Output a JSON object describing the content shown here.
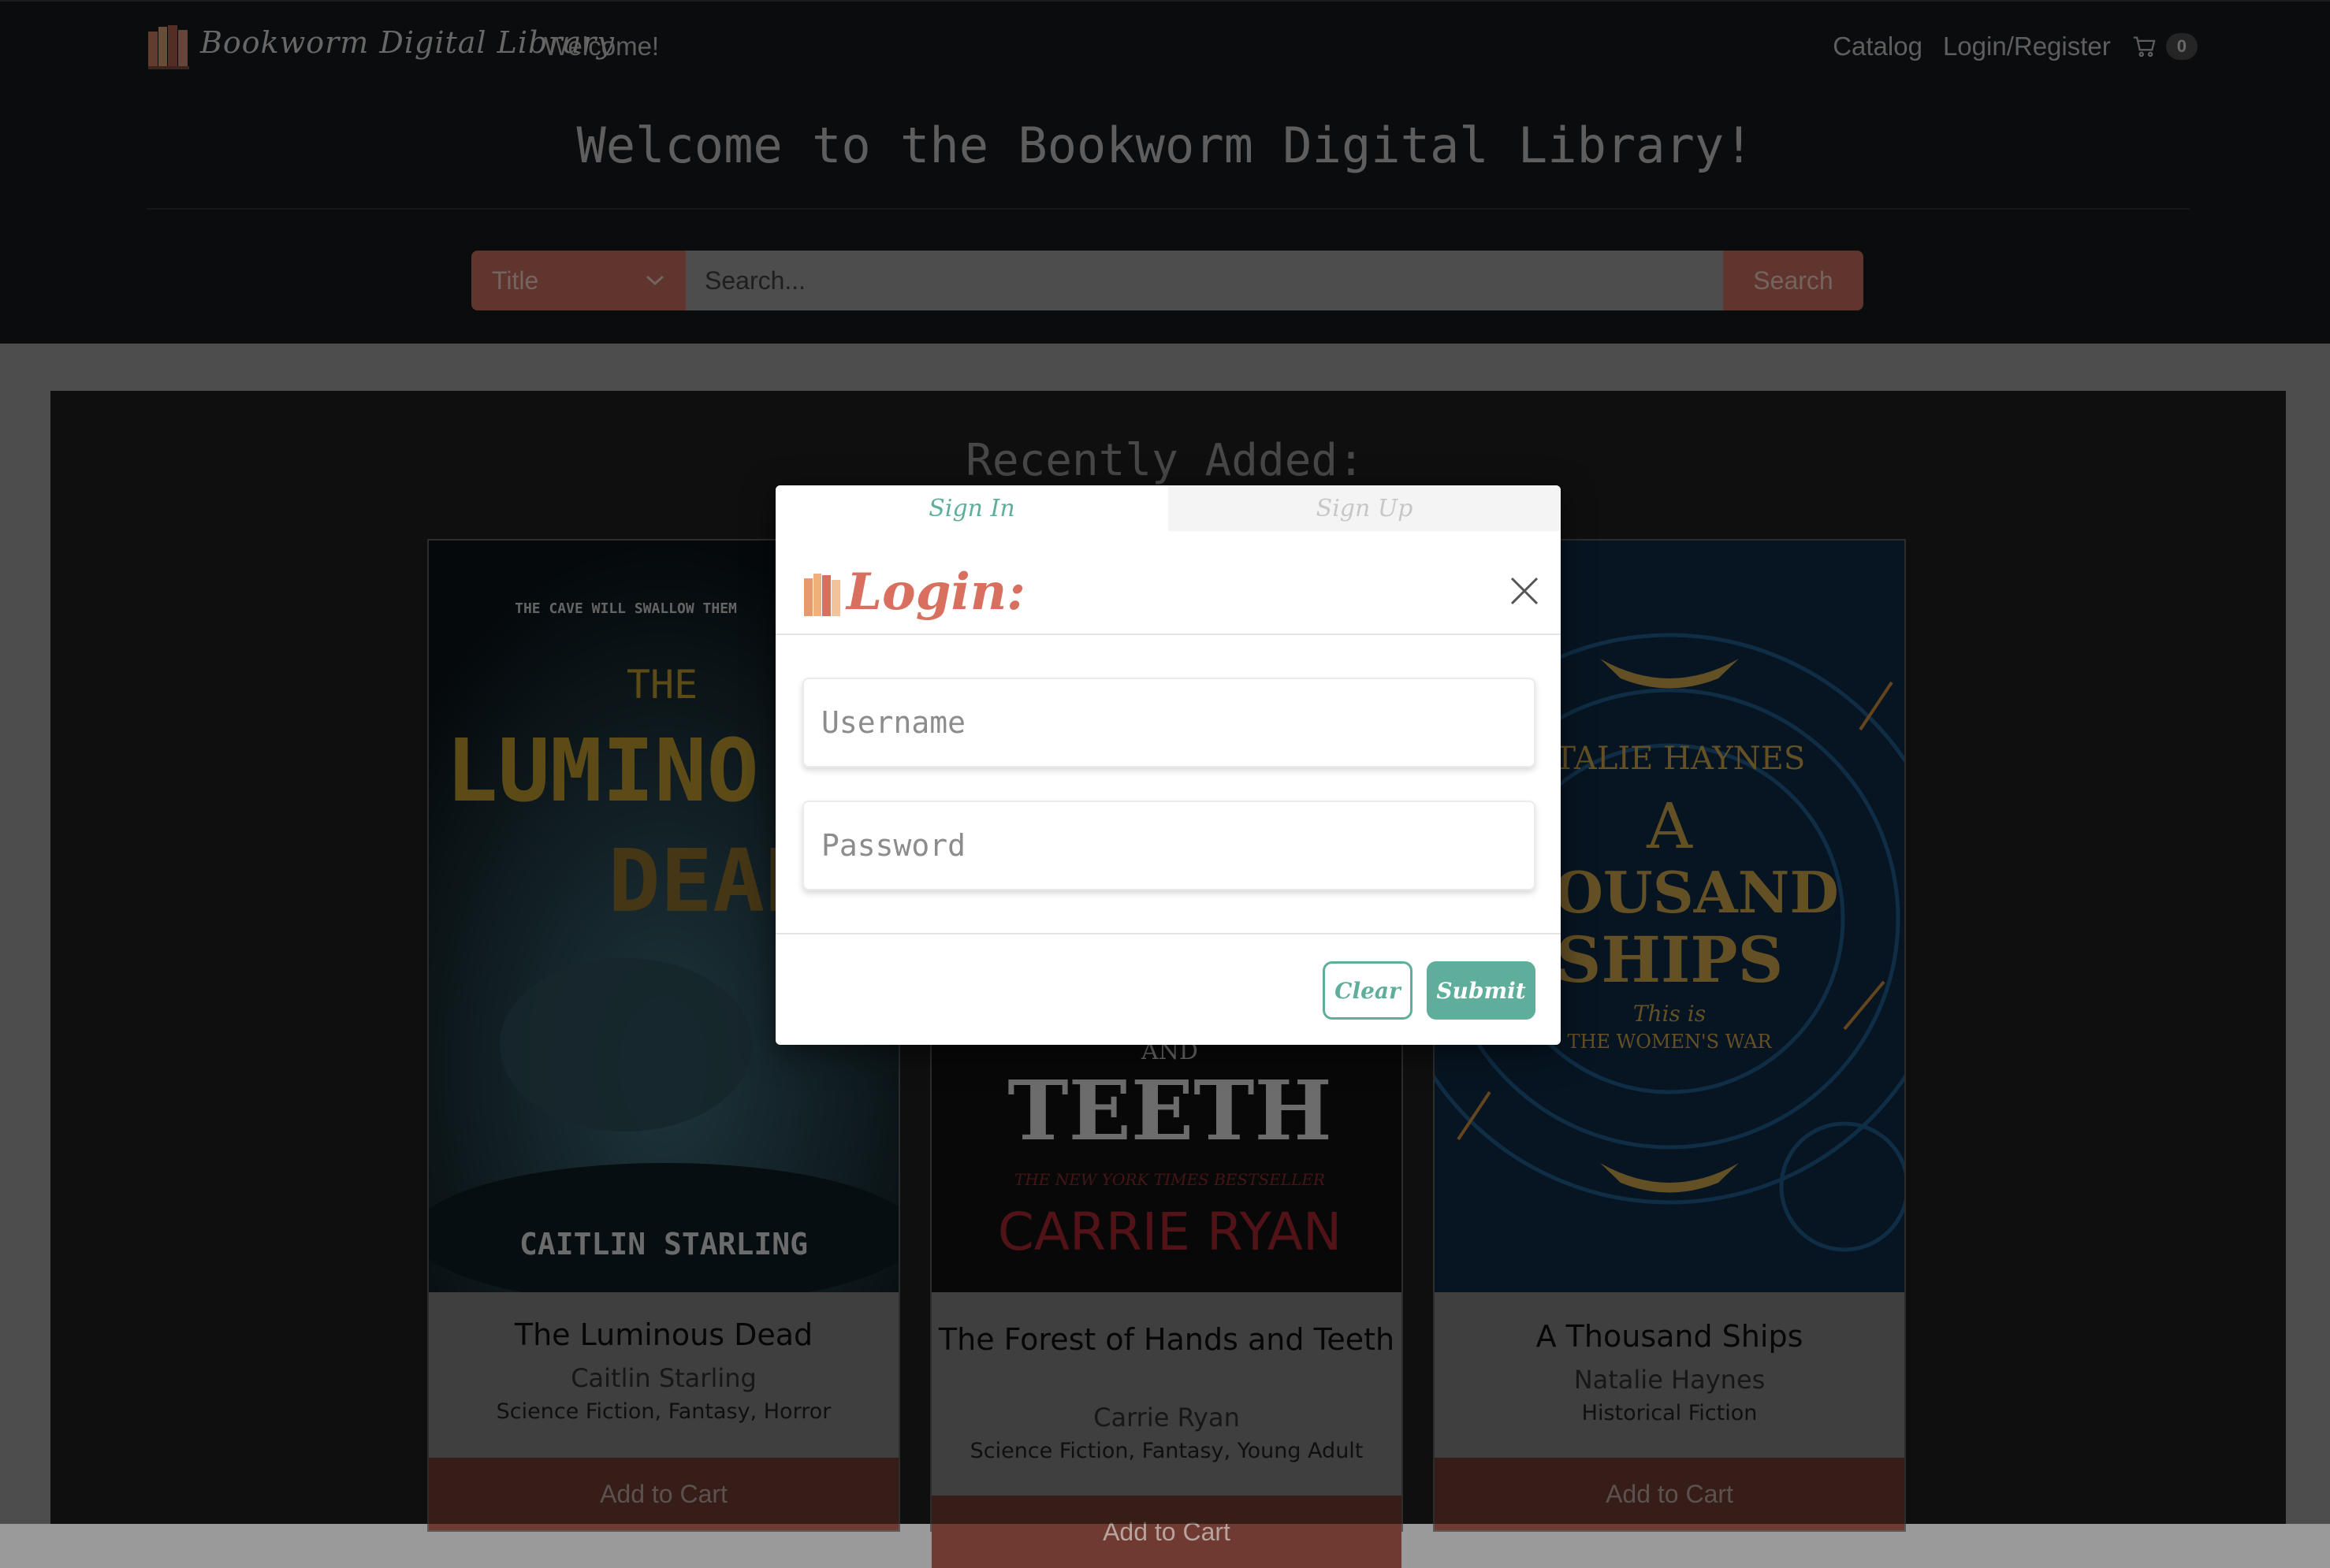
{
  "brand": {
    "name": "Bookworm Digital Library",
    "welcome": "Welcome!"
  },
  "nav": {
    "catalog": "Catalog",
    "login_register": "Login/Register",
    "cart_count": "0"
  },
  "hero": {
    "title": "Welcome to the Bookworm Digital Library!"
  },
  "search": {
    "category": "Title",
    "placeholder": "Search...",
    "button": "Search"
  },
  "section": {
    "title": "Recently Added:"
  },
  "books": [
    {
      "title": "The Luminous Dead",
      "author": "Caitlin Starling",
      "genres": "Science Fiction, Fantasy, Horror",
      "button": "Add to Cart",
      "cover_lines": [
        "THE CAVE WILL SWALLOW THEM",
        "THE",
        "LUMINO",
        "DEAD",
        "CAITLIN STARLING"
      ]
    },
    {
      "title": "The Forest of Hands and Teeth",
      "author": "Carrie Ryan",
      "genres": "Science Fiction, Fantasy, Young Adult",
      "button": "Add to Cart",
      "cover_lines": [
        "AND",
        "TEETH",
        "THE NEW YORK TIMES BESTSELLER",
        "CARRIE RYAN"
      ]
    },
    {
      "title": "A Thousand Ships",
      "author": "Natalie Haynes",
      "genres": "Historical Fiction",
      "button": "Add to Cart",
      "cover_lines": [
        "ATALIE HAYNES",
        "A",
        "HOUSAND",
        "SHIPS",
        "This is",
        "THE WOMEN'S WAR"
      ]
    }
  ],
  "modal": {
    "tabs": [
      "Sign In",
      "Sign Up"
    ],
    "title": "Login:",
    "username_placeholder": "Username",
    "password_placeholder": "Password",
    "clear": "Clear",
    "submit": "Submit"
  },
  "colors": {
    "accent": "#c06b5b",
    "teal": "#5fae9b",
    "login_title": "#d9705f"
  }
}
